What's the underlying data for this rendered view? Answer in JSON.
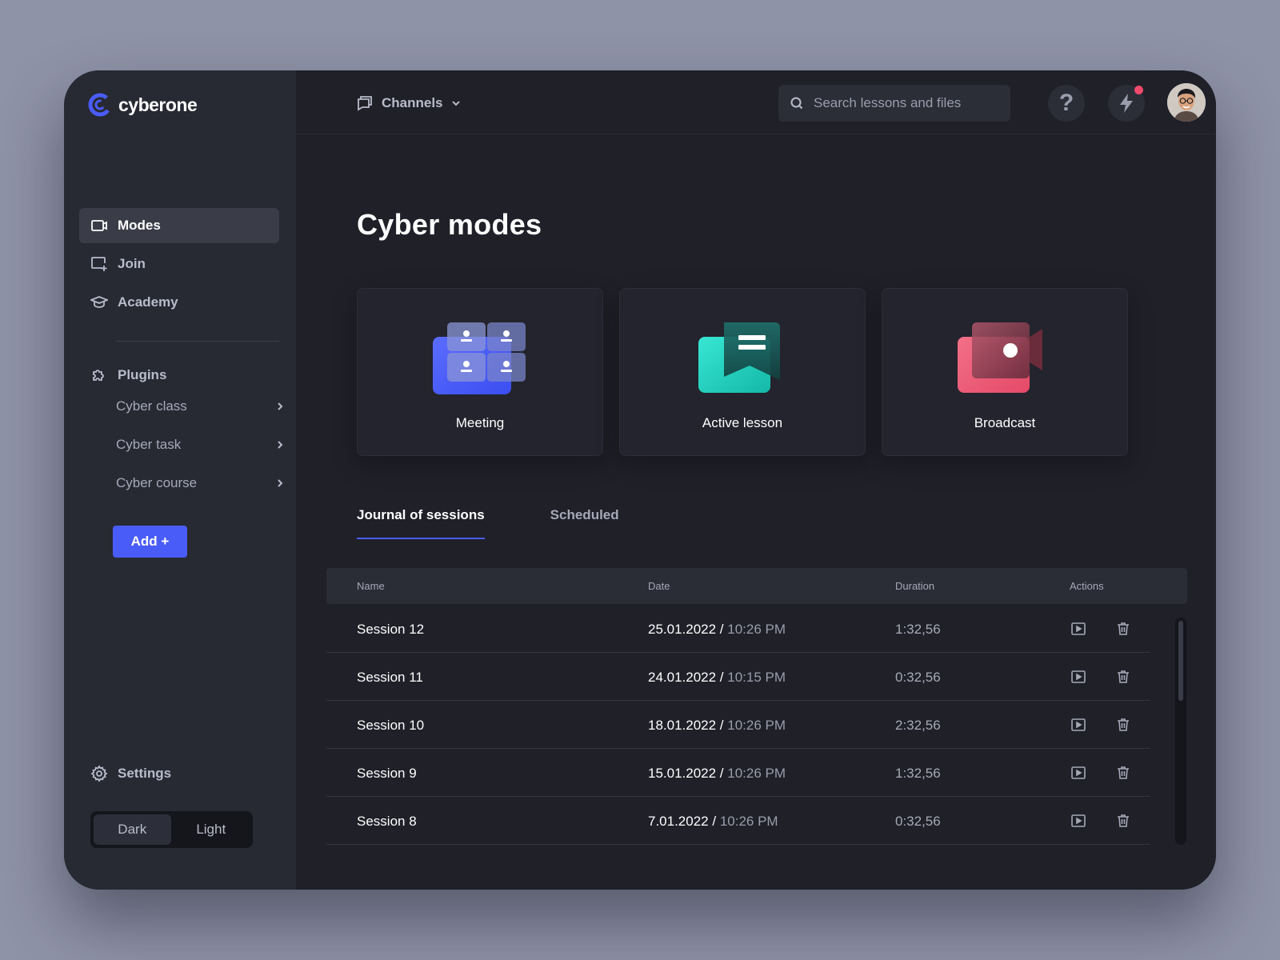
{
  "brand": {
    "name": "cyberone",
    "accent": "#4a5cf7"
  },
  "sidebar": {
    "nav": [
      {
        "label": "Modes",
        "icon": "video-icon",
        "active": true
      },
      {
        "label": "Join",
        "icon": "join-screen-icon",
        "active": false
      },
      {
        "label": "Academy",
        "icon": "graduation-cap-icon",
        "active": false
      }
    ],
    "plugins_label": "Plugins",
    "plugin_items": [
      {
        "label": "Cyber class"
      },
      {
        "label": "Cyber task"
      },
      {
        "label": "Cyber course"
      }
    ],
    "add_label": "Add +",
    "settings_label": "Settings",
    "theme": {
      "dark": "Dark",
      "light": "Light",
      "selected": "Dark"
    }
  },
  "topbar": {
    "channels_label": "Channels",
    "search_placeholder": "Search lessons and files",
    "help_label": "?",
    "notification_dot_color": "#ef4a6b"
  },
  "main": {
    "title": "Cyber modes",
    "modes": [
      {
        "label": "Meeting",
        "icon": "meeting-grid-icon",
        "color": "#4a5cf7"
      },
      {
        "label": "Active lesson",
        "icon": "chat-bubble-icon",
        "color": "#1fd1bf"
      },
      {
        "label": "Broadcast",
        "icon": "camera-icon",
        "color": "#ee5a78"
      }
    ],
    "tabs": [
      {
        "label": "Journal of sessions",
        "active": true
      },
      {
        "label": "Scheduled",
        "active": false
      }
    ],
    "table": {
      "headers": {
        "name": "Name",
        "date": "Date",
        "duration": "Duration",
        "actions": "Actions"
      },
      "rows": [
        {
          "name": "Session 12",
          "date": "25.01.2022 /",
          "time": "10:26 PM",
          "duration": "1:32,56"
        },
        {
          "name": "Session 11",
          "date": "24.01.2022 /",
          "time": "10:15 PM",
          "duration": "0:32,56"
        },
        {
          "name": "Session 10",
          "date": "18.01.2022 /",
          "time": "10:26 PM",
          "duration": "2:32,56"
        },
        {
          "name": "Session 9",
          "date": "15.01.2022 /",
          "time": "10:26 PM",
          "duration": "1:32,56"
        },
        {
          "name": "Session 8",
          "date": "7.01.2022 /",
          "time": "10:26 PM",
          "duration": "0:32,56"
        }
      ]
    }
  }
}
